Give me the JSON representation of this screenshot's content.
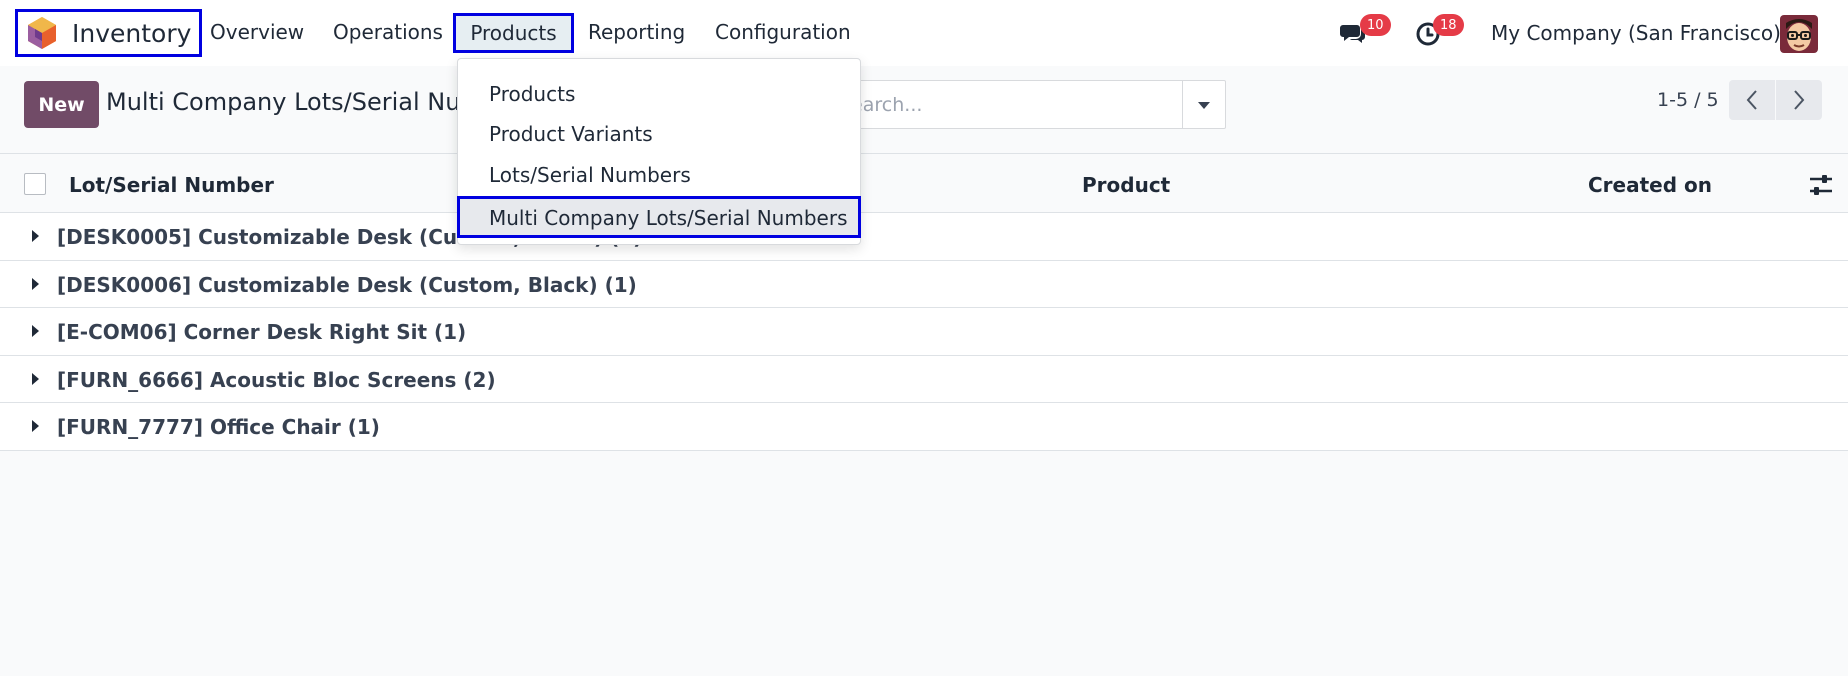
{
  "navbar": {
    "app_name": "Inventory",
    "menu": [
      "Overview",
      "Operations",
      "Products",
      "Reporting",
      "Configuration"
    ],
    "messages_count": "10",
    "activities_count": "18",
    "company": "My Company (San Francisco)"
  },
  "control_panel": {
    "new_label": "New",
    "title": "Multi Company Lots/Serial Numbers",
    "search_placeholder": "Search...",
    "pager": "1-5 / 5"
  },
  "list": {
    "columns": [
      "Lot/Serial Number",
      "Product",
      "Created on"
    ],
    "groups": [
      "[DESK0005] Customizable Desk (Custom, White) (1)",
      "[DESK0006] Customizable Desk (Custom, Black) (1)",
      "[E-COM06] Corner Desk Right Sit (1)",
      "[FURN_6666] Acoustic Bloc Screens (2)",
      "[FURN_7777] Office Chair (1)"
    ]
  },
  "products_dropdown": {
    "items": [
      "Products",
      "Product Variants",
      "Lots/Serial Numbers",
      "Multi Company Lots/Serial Numbers"
    ]
  },
  "colors": {
    "primary": "#714b67",
    "highlight_border": "#0000e0",
    "badge": "#e53b47"
  }
}
